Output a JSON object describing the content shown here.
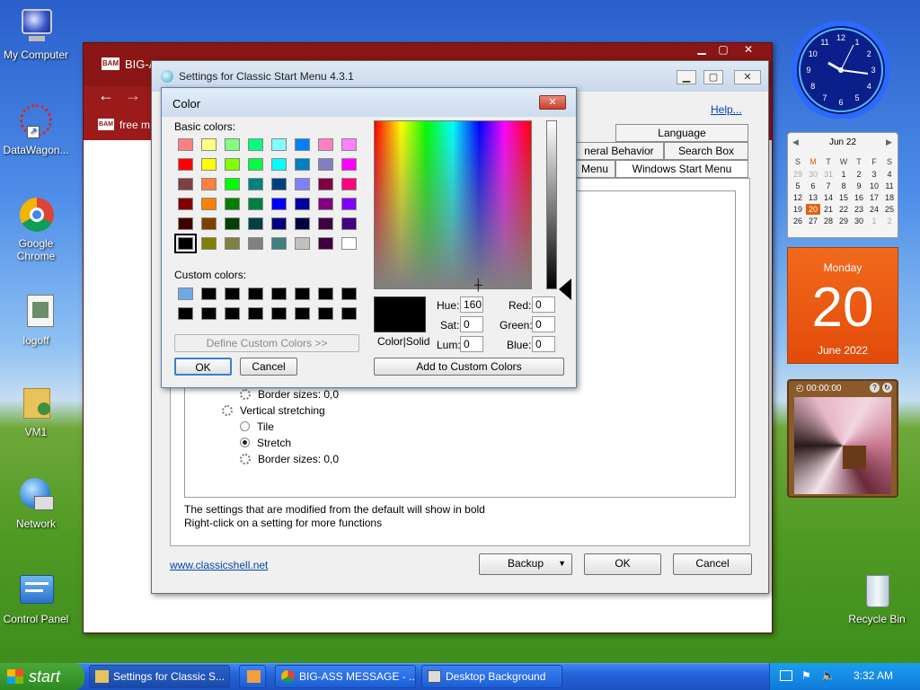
{
  "desktop": {
    "icons": [
      {
        "label": "My Computer"
      },
      {
        "label": "DataWagon..."
      },
      {
        "label": "Google Chrome"
      },
      {
        "label": "logoff"
      },
      {
        "label": "VM1"
      },
      {
        "label": "Network"
      },
      {
        "label": "Control Panel"
      },
      {
        "label": "Recycle Bin"
      }
    ]
  },
  "browser_window": {
    "title": "BIG-A",
    "tab_text": "free m",
    "tab_badge": "BAM",
    "title_badge": "BAM"
  },
  "settings_window": {
    "title": "Settings for Classic Start Menu 4.3.1",
    "help_link": "Help...",
    "tabs": {
      "language": "Language",
      "general_behavior": "neral Behavior",
      "search_box": "Search Box",
      "menu": "Menu",
      "windows_start_menu": "Windows Start Menu"
    },
    "tree": {
      "border_sizes_top": "Border sizes: 0,0",
      "vertical_stretching": "Vertical stretching",
      "tile": "Tile",
      "stretch": "Stretch",
      "border_sizes_bottom": "Border sizes: 0,0"
    },
    "info_line1": "The settings that are modified from the default will show in bold",
    "info_line2": "Right-click on a setting for more functions",
    "website_link": "www.classicshell.net",
    "backup_button": "Backup",
    "ok_button": "OK",
    "cancel_button": "Cancel"
  },
  "color_dialog": {
    "title": "Color",
    "basic_colors_label": "Basic colors:",
    "custom_colors_label": "Custom colors:",
    "define_custom_button": "Define Custom Colors >>",
    "ok_button": "OK",
    "cancel_button": "Cancel",
    "color_solid_label": "Color|Solid",
    "hue_label": "Hue:",
    "hue_value": "160",
    "sat_label": "Sat:",
    "sat_value": "0",
    "lum_label": "Lum:",
    "lum_value": "0",
    "red_label": "Red:",
    "red_value": "0",
    "green_label": "Green:",
    "green_value": "0",
    "blue_label": "Blue:",
    "blue_value": "0",
    "add_custom_button": "Add to Custom Colors",
    "basic_colors": [
      "#ff8080",
      "#ffff80",
      "#80ff80",
      "#00ff80",
      "#80ffff",
      "#0080ff",
      "#ff80c0",
      "#ff80ff",
      "#ff0000",
      "#ffff00",
      "#80ff00",
      "#00ff40",
      "#00ffff",
      "#0080c0",
      "#8080c0",
      "#ff00ff",
      "#804040",
      "#ff8040",
      "#00ff00",
      "#008080",
      "#004080",
      "#8080ff",
      "#800040",
      "#ff0080",
      "#800000",
      "#ff8000",
      "#008000",
      "#008040",
      "#0000ff",
      "#0000a0",
      "#800080",
      "#8000ff",
      "#400000",
      "#804000",
      "#004000",
      "#004040",
      "#000080",
      "#000040",
      "#400040",
      "#400080",
      "#000000",
      "#808000",
      "#808040",
      "#808080",
      "#408080",
      "#c0c0c0",
      "#400040",
      "#ffffff"
    ],
    "custom_colors": [
      "#6fa8e8",
      "#000000",
      "#000000",
      "#000000",
      "#000000",
      "#000000",
      "#000000",
      "#000000",
      "#000000",
      "#000000",
      "#000000",
      "#000000",
      "#000000",
      "#000000",
      "#000000",
      "#000000"
    ]
  },
  "gadgets": {
    "calendar": {
      "month_header": "Jun 22",
      "weekdays": [
        "S",
        "M",
        "T",
        "W",
        "T",
        "F",
        "S"
      ],
      "days": [
        "29",
        "30",
        "31",
        "1",
        "2",
        "3",
        "4",
        "5",
        "6",
        "7",
        "8",
        "9",
        "10",
        "11",
        "12",
        "13",
        "14",
        "15",
        "16",
        "17",
        "18",
        "19",
        "20",
        "21",
        "22",
        "23",
        "24",
        "25",
        "26",
        "27",
        "28",
        "29",
        "30",
        "1",
        "2"
      ],
      "weekday_name": "Monday",
      "big_day": "20",
      "month_year": "June 2022"
    },
    "clock": {
      "numbers": [
        "12",
        "1",
        "2",
        "3",
        "4",
        "5",
        "6",
        "7",
        "8",
        "9",
        "10",
        "11"
      ]
    },
    "puzzle": {
      "timer": "00:00:00"
    }
  },
  "taskbar": {
    "start_label": "start",
    "tasks": [
      {
        "label": "Settings for Classic S..."
      },
      {
        "label": "BIG-ASS MESSAGE - ..."
      },
      {
        "label": "Desktop Background"
      }
    ],
    "time": "3:32 AM"
  }
}
